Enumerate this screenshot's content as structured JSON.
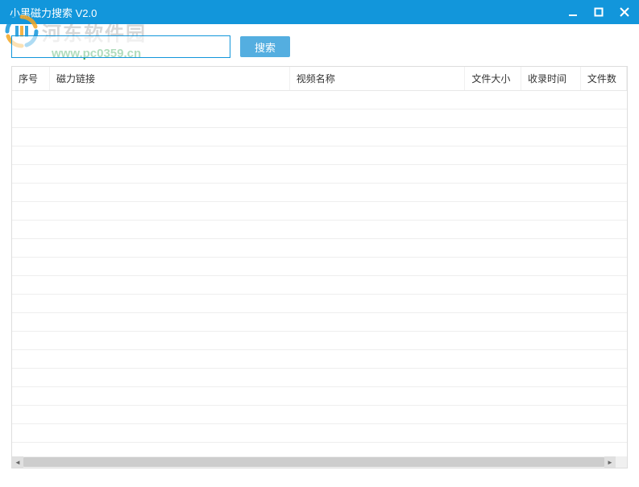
{
  "window": {
    "title": "小黑磁力搜索 V2.0"
  },
  "watermark": {
    "text": "河东软件园",
    "url": "www.pc0359.cn"
  },
  "toolbar": {
    "search_value": "",
    "search_placeholder": "",
    "search_button": "搜索"
  },
  "table": {
    "columns": {
      "seq": "序号",
      "link": "磁力链接",
      "name": "视频名称",
      "size": "文件大小",
      "time": "收录时间",
      "count": "文件数"
    },
    "rows": []
  }
}
